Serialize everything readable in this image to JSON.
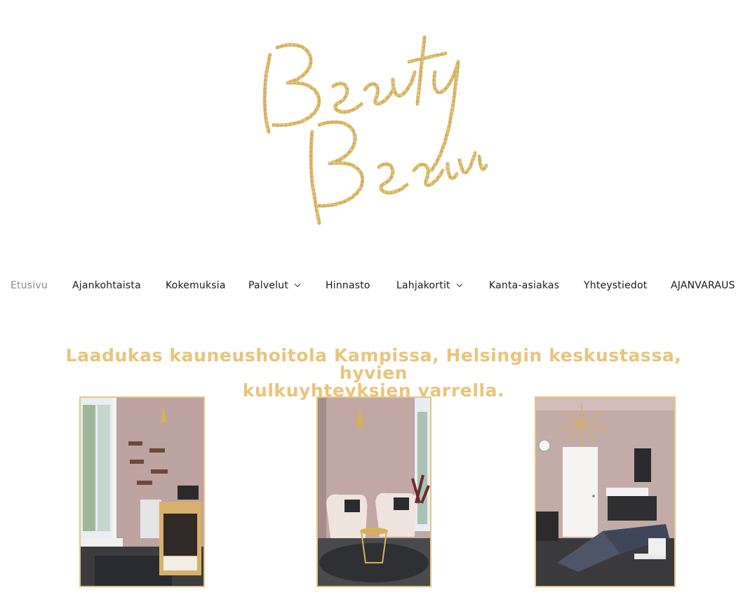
{
  "logo": {
    "line1": "Beauty",
    "line2": "Beaivi",
    "color": "#d8b868"
  },
  "nav": {
    "items": [
      {
        "label": "Etusivu",
        "active": true
      },
      {
        "label": "Ajankohtaista"
      },
      {
        "label": "Kokemuksia"
      },
      {
        "label": "Palvelut",
        "dropdown": true
      },
      {
        "label": "Hinnasto"
      },
      {
        "label": "Lahjakortit",
        "dropdown": true
      },
      {
        "label": "Kanta-asiakas"
      },
      {
        "label": "Yhteystiedot"
      },
      {
        "label": "AJANVARAUS"
      }
    ]
  },
  "main": {
    "headline_line1": "Laadukas kauneushoitola Kampissa, Helsingin keskustassa, hyvien",
    "headline_line2": "kulkuyhteyksien varrella."
  },
  "colors": {
    "accent": "#e8c57a",
    "frame": "#e3c58a",
    "wall": "#bca3a0"
  }
}
